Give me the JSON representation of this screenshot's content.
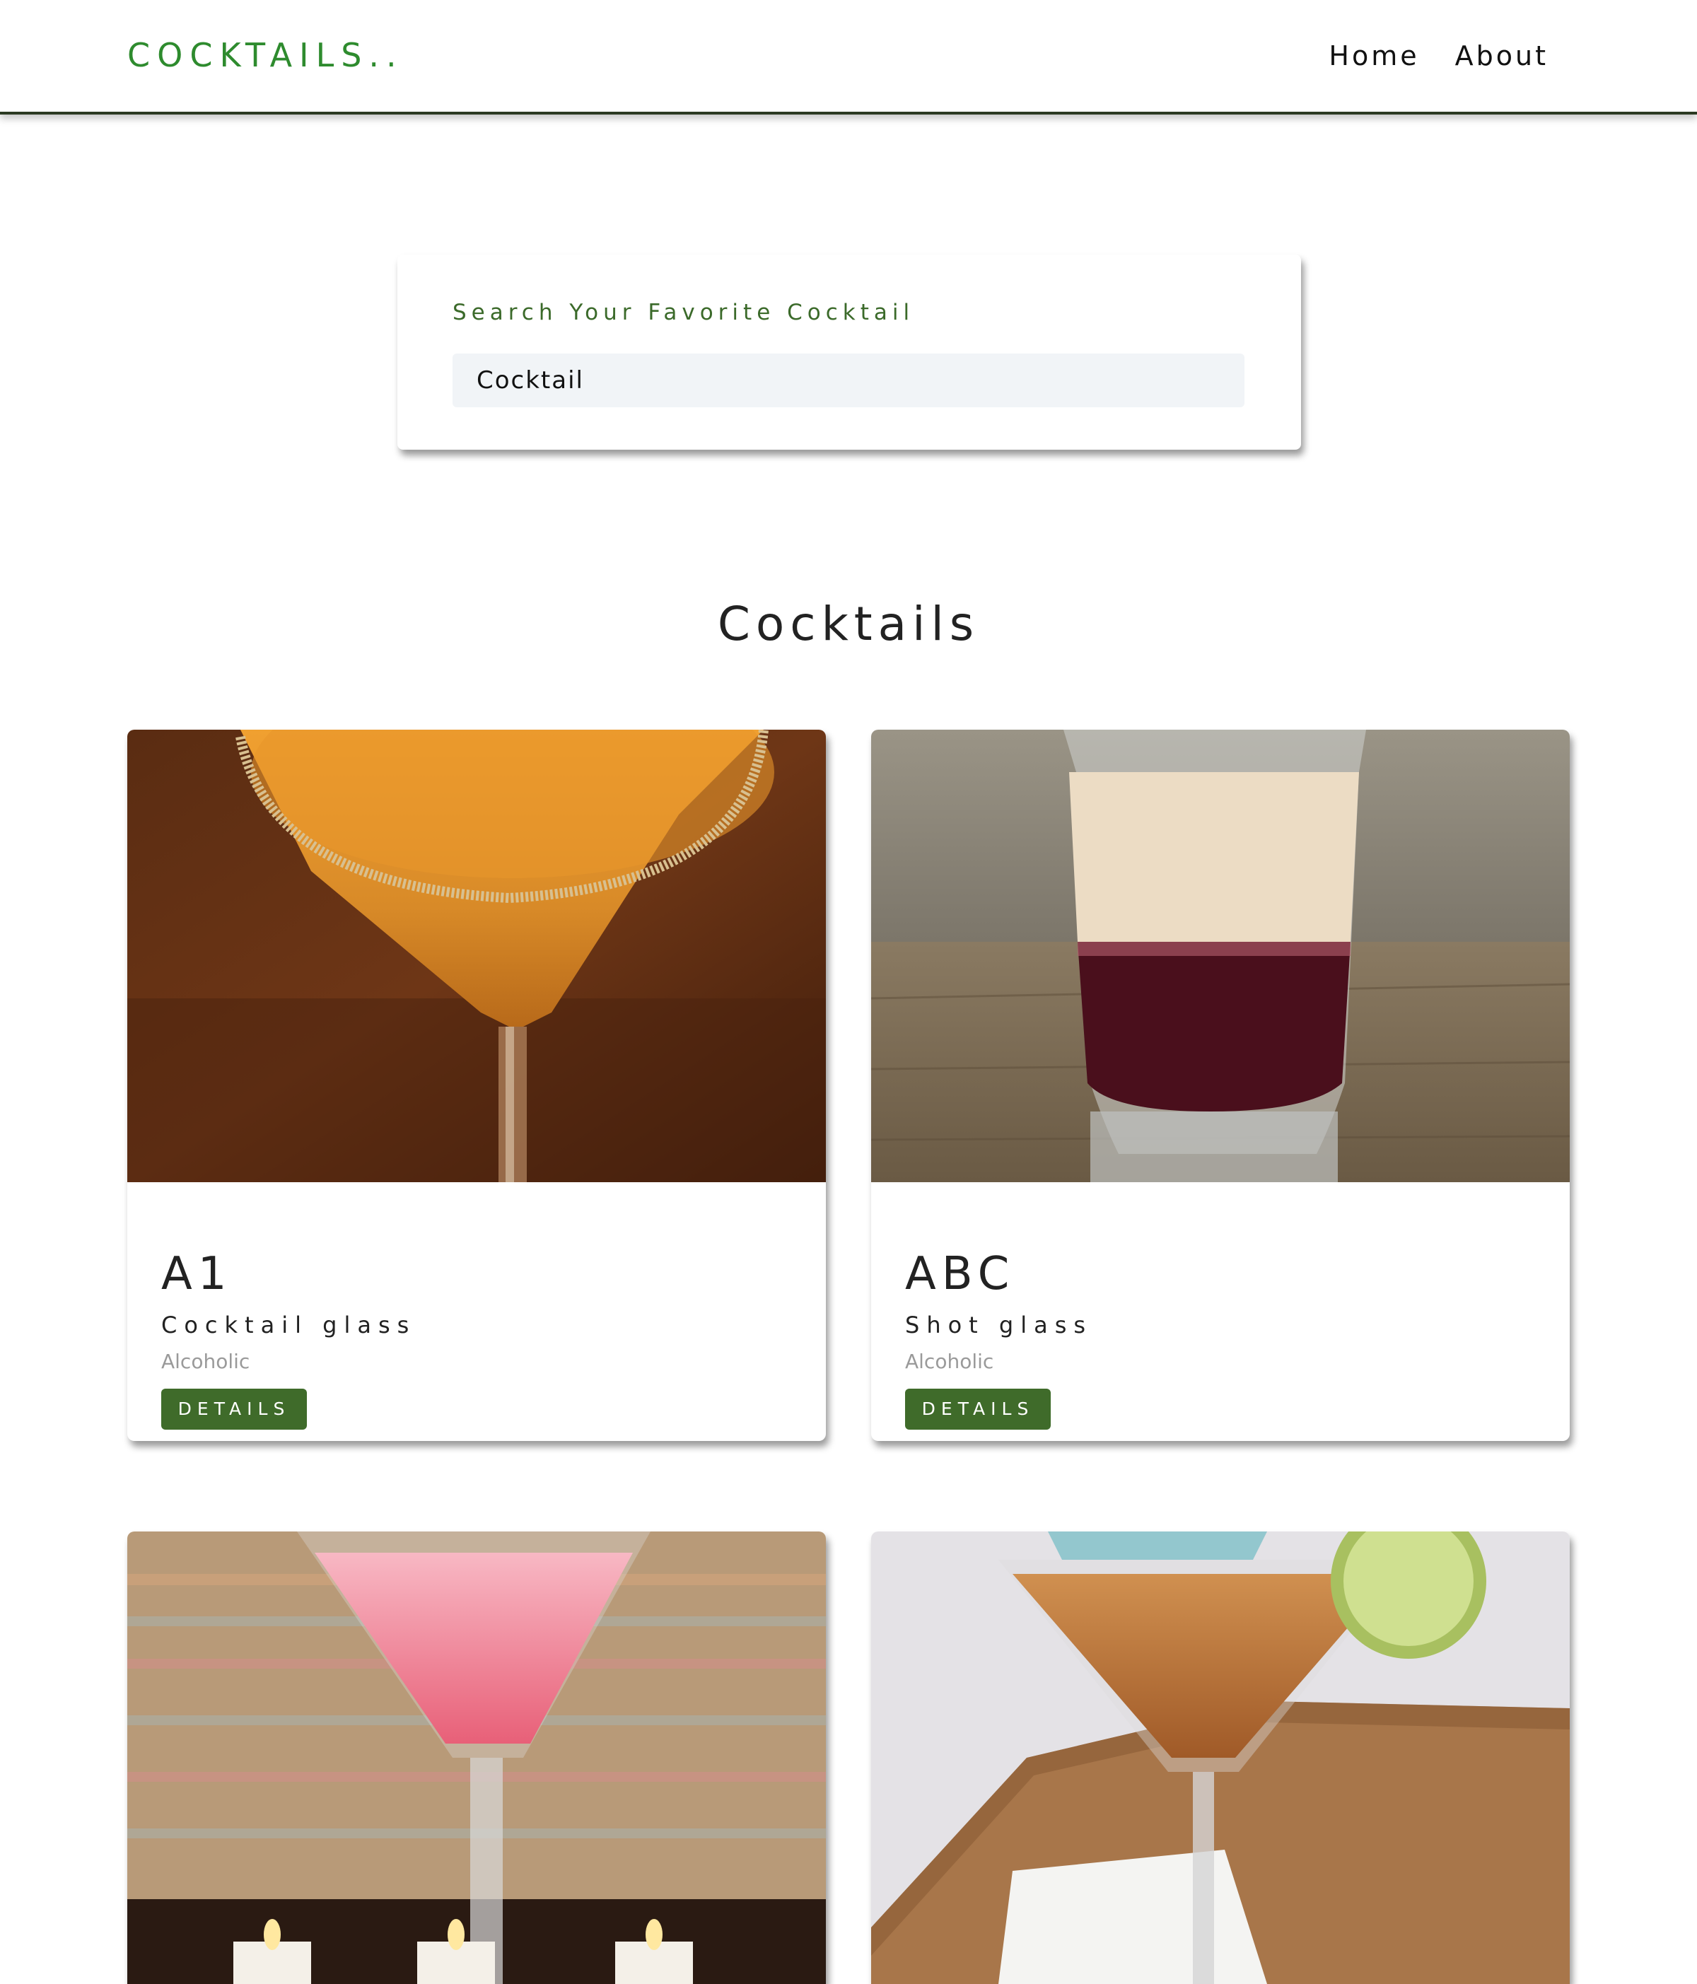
{
  "navbar": {
    "logo": "COCKTAILS..",
    "links": [
      "Home",
      "About"
    ]
  },
  "search": {
    "label": "Search Your Favorite Cocktail",
    "value": "Cocktail"
  },
  "section": {
    "title": "Cocktails"
  },
  "cards": [
    {
      "name": "A1",
      "glass": "Cocktail glass",
      "type": "Alcoholic",
      "button": "DETAILS",
      "image": "orange cocktail in sugar-rimmed martini glass"
    },
    {
      "name": "ABC",
      "glass": "Shot glass",
      "type": "Alcoholic",
      "button": "DETAILS",
      "image": "layered cream and red shot in shot glass"
    },
    {
      "image": "pink cocktail in martini glass with tea lights"
    },
    {
      "image": "amber cocktail in martini glass with lime wheel on wooden table"
    }
  ],
  "colors": {
    "brand": "#2e8b2e",
    "button": "#3f6b2a",
    "search_label": "#3b6a2a",
    "input_bg": "#f1f4f7",
    "muted": "#9a9a9a"
  }
}
